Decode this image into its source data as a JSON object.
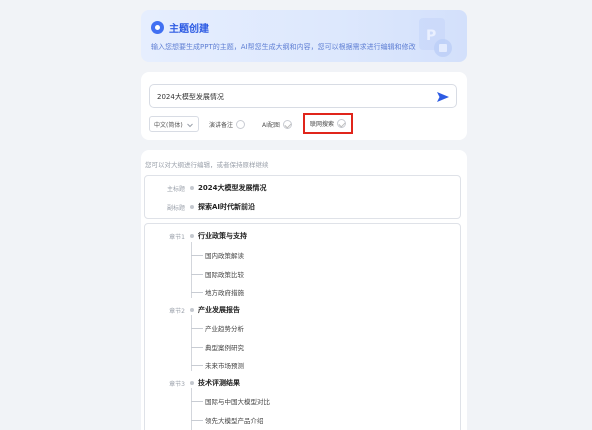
{
  "banner": {
    "title": "主题创建",
    "description": "输入您想要生成PPT的主题，AI帮您生成大纲和内容，您可以根据需求进行编辑和修改"
  },
  "input": {
    "value": "2024大模型发展情况"
  },
  "options": {
    "language": "中文(简体)",
    "speaker_notes": "演讲备注",
    "ai_image": "AI配图",
    "web_search": "联网搜索"
  },
  "outline": {
    "hint": "您可以对大纲进行编辑，或者保持原样继续",
    "main_title_label": "主标题",
    "main_title": "2024大模型发展情况",
    "subtitle_label": "副标题",
    "subtitle": "探索AI时代新前沿",
    "chapters": [
      {
        "label": "章节1",
        "title": "行业政策与支持",
        "items": [
          "国内政策解读",
          "国际政策比较",
          "地方政府措施"
        ]
      },
      {
        "label": "章节2",
        "title": "产业发展报告",
        "items": [
          "产业趋势分析",
          "典型案例研究",
          "未来市场预测"
        ]
      },
      {
        "label": "章节3",
        "title": "技术评测结果",
        "items": [
          "国际与中国大模型对比",
          "领先大模型产品介绍"
        ]
      }
    ]
  },
  "colors": {
    "accent": "#2d5be3",
    "highlight_box": "#e0251b"
  }
}
